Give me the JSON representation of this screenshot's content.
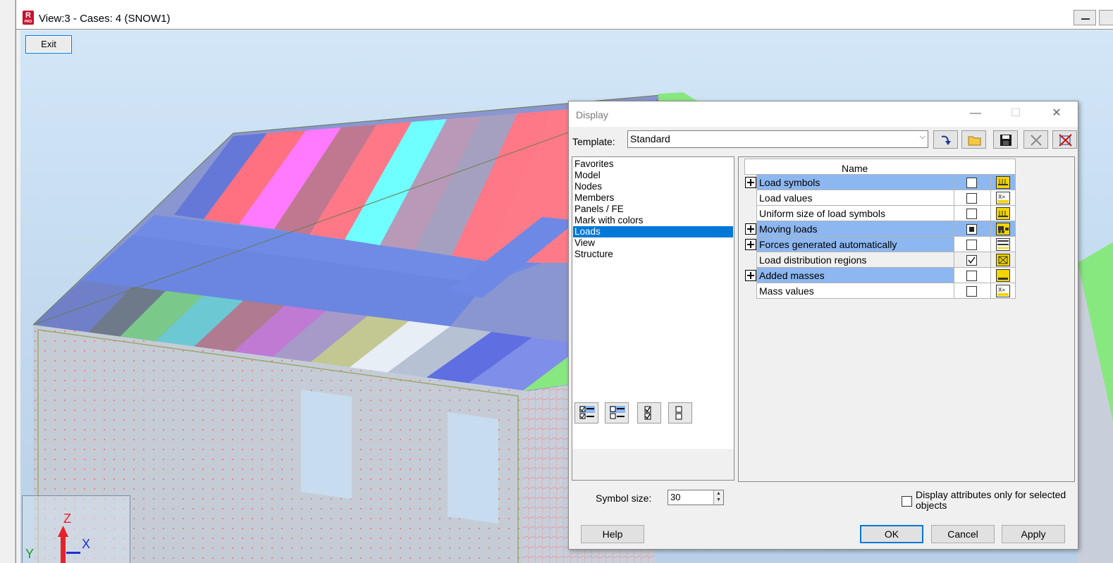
{
  "window": {
    "app_badge": "R",
    "app_badge_sub": "PRO",
    "title": "View:3 - Cases: 4 (SNOW1)"
  },
  "viewport": {
    "exit_label": "Exit",
    "axes": {
      "z": "Z",
      "x": "X",
      "y": "Y"
    }
  },
  "dialog": {
    "title": "Display",
    "min_glyph": "—",
    "max_glyph": "☐",
    "close_glyph": "✕",
    "template_label": "Template:",
    "template_value": "Standard",
    "template_arrow": "⌵",
    "toolbar_icons": [
      "apply-template-icon",
      "open-folder-icon",
      "save-icon",
      "delete-icon",
      "delete-all-icon"
    ],
    "categories": [
      "Favorites",
      "Model",
      "Nodes",
      "Members",
      "Panels / FE",
      "Mark with colors",
      "Loads",
      "View",
      "Structure"
    ],
    "selected_category": "Loads",
    "list_buttons": [
      "select-all-icon",
      "expand-all-icon",
      "check-all-icon",
      "uncheck-all-icon"
    ],
    "grid_header": "Name",
    "rows": [
      {
        "name": "Load symbols",
        "expandable": true,
        "highlighted": true,
        "checked": false,
        "icon": "load-symbols-icon"
      },
      {
        "name": "Load values",
        "expandable": false,
        "highlighted": false,
        "checked": false,
        "icon": "load-values-icon"
      },
      {
        "name": "Uniform size of load symbols",
        "expandable": false,
        "highlighted": false,
        "checked": false,
        "icon": "uniform-size-icon"
      },
      {
        "name": "Moving loads",
        "expandable": true,
        "highlighted": true,
        "checked": "partial",
        "icon": "moving-loads-icon"
      },
      {
        "name": "Forces generated automatically",
        "expandable": true,
        "highlighted": true,
        "checked": false,
        "icon": "forces-generated-icon"
      },
      {
        "name": "Load distribution regions",
        "expandable": false,
        "highlighted": false,
        "checked": true,
        "icon": "load-distribution-icon"
      },
      {
        "name": "Added masses",
        "expandable": true,
        "highlighted": true,
        "checked": false,
        "icon": "added-masses-icon"
      },
      {
        "name": "Mass values",
        "expandable": false,
        "highlighted": false,
        "checked": false,
        "icon": "mass-values-icon"
      }
    ],
    "symbol_size_label": "Symbol size:",
    "symbol_size_value": "30",
    "attr_label": "Display attributes only for selected objects",
    "buttons": {
      "help": "Help",
      "ok": "OK",
      "cancel": "Cancel",
      "apply": "Apply"
    }
  },
  "colors": {
    "row_highlight": "#8db7f0",
    "selection": "#0078d7",
    "marker_yellow": "#f8ff00"
  }
}
